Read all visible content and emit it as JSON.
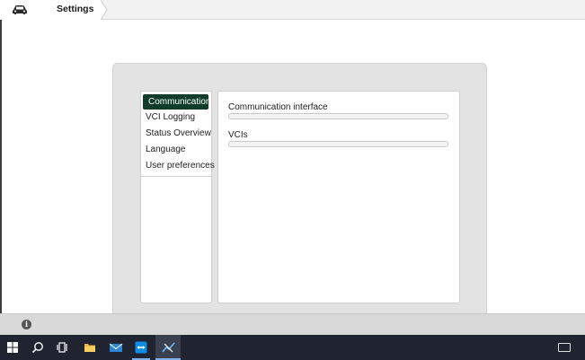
{
  "breadcrumb": {
    "home_icon": "car-icon",
    "current": "Settings"
  },
  "settings_menu": {
    "items": [
      {
        "label": "Communication",
        "active": true
      },
      {
        "label": "VCI Logging",
        "active": false
      },
      {
        "label": "Status Overview",
        "active": false
      },
      {
        "label": "Language",
        "active": false
      },
      {
        "label": "User preferences",
        "active": false
      }
    ]
  },
  "content": {
    "fields": [
      {
        "label": "Communication interface",
        "value": ""
      },
      {
        "label": "VCIs",
        "value": ""
      }
    ]
  },
  "footer": {
    "icon": "info-icon",
    "info_glyph": "i"
  },
  "taskbar": {
    "items": [
      "windows-start-icon",
      "search-icon",
      "task-view-icon",
      "file-explorer-icon",
      "mail-icon",
      "teamviewer-icon",
      "diagnostic-app-icon"
    ],
    "tray": [
      "keyboard-icon"
    ]
  },
  "colors": {
    "accent": "#0f3d2a",
    "panel": "#e3e3e3",
    "taskbar": "#1f2430"
  }
}
